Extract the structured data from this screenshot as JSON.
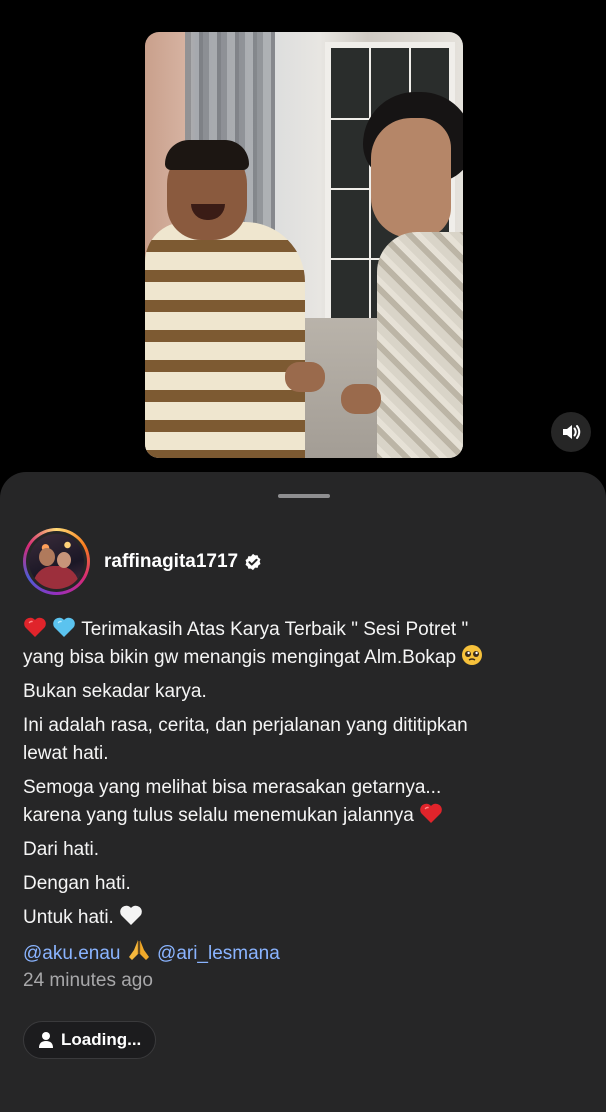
{
  "post": {
    "username": "raffinagita1717",
    "caption": {
      "line1_text": "Terimakasih Atas Karya Terbaik \" Sesi Potret \"",
      "line2_text": "yang bisa bikin gw menangis mengingat Alm.Bokap",
      "p2": "Bukan sekadar karya.",
      "p3a": "Ini adalah rasa, cerita, dan perjalanan yang dititipkan",
      "p3b": "lewat hati.",
      "p4a": "Semoga yang melihat bisa merasakan getarnya...",
      "p4b": "karena yang tulus selalu menemukan jalannya",
      "p5": "Dari hati.",
      "p6": "Dengan hati.",
      "p7": "Untuk hati."
    },
    "mentions": [
      "@aku.enau",
      "@ari_lesmana"
    ],
    "timestamp": "24 minutes ago",
    "loading_label": "Loading..."
  },
  "icons": {
    "mute_toggle": "speaker-icon",
    "verified": "verified-badge-icon",
    "loading_user": "user-icon"
  },
  "colors": {
    "sheet_bg": "#262627",
    "mention": "#8ab4ff",
    "timestamp": "#a8a8aa"
  }
}
